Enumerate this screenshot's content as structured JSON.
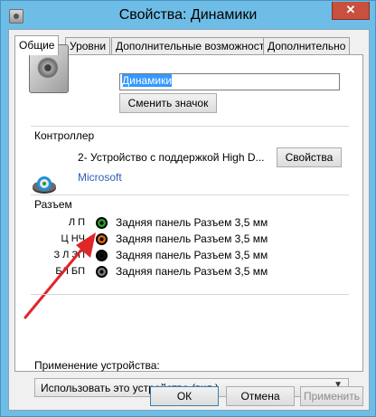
{
  "window": {
    "title": "Свойства: Динамики",
    "close_label": "✕"
  },
  "tabs": [
    {
      "label": "Общие"
    },
    {
      "label": "Уровни"
    },
    {
      "label": "Дополнительные возможности"
    },
    {
      "label": "Дополнительно"
    }
  ],
  "general": {
    "device_name": "Динамики",
    "change_icon_label": "Сменить значок"
  },
  "controller": {
    "heading": "Контроллер",
    "name": "2- Устройство с поддержкой High D...",
    "properties_label": "Свойства",
    "vendor": "Microsoft"
  },
  "jacks": {
    "heading": "Разъем",
    "items": [
      {
        "name": "Л П",
        "color": "#22aa22",
        "description": "Задняя панель Разъем 3,5 мм"
      },
      {
        "name": "Ц НЧ",
        "color": "#e06a10",
        "description": "Задняя панель Разъем 3,5 мм"
      },
      {
        "name": "З Л ЗП",
        "color": "#111111",
        "description": "Задняя панель Разъем 3,5 мм"
      },
      {
        "name": "БЛ БП",
        "color": "#7f7f7f",
        "description": "Задняя панель Разъем 3,5 мм"
      }
    ]
  },
  "usage": {
    "label": "Применение устройства:",
    "selected": "Использовать это устройство (вкл.)"
  },
  "footer": {
    "ok": "ОК",
    "cancel": "Отмена",
    "apply": "Применить"
  },
  "colors": {
    "accent_arrow": "#e0262a",
    "title_bar": "#6ebde6",
    "close_button": "#c7503f"
  }
}
